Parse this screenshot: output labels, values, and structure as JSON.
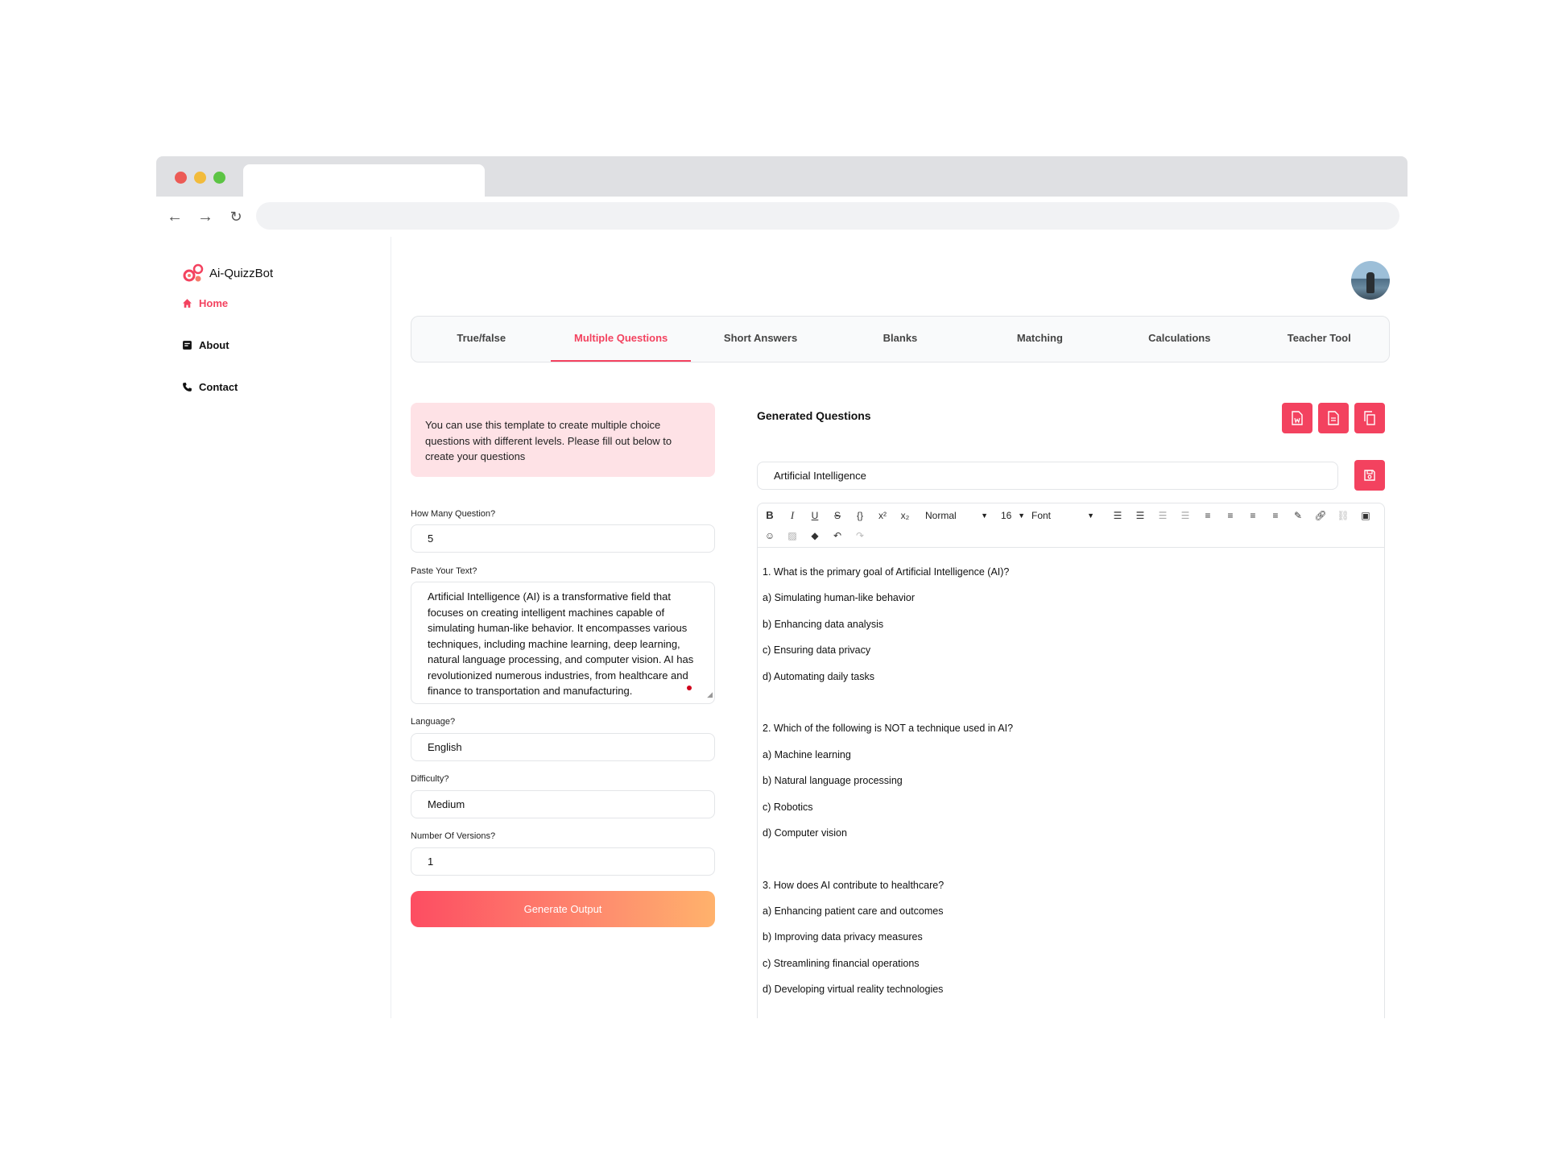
{
  "app": {
    "name": "Ai-QuizzBot"
  },
  "sidebar": {
    "items": [
      {
        "label": "Home",
        "icon": "home-icon",
        "active": true
      },
      {
        "label": "About",
        "icon": "document-icon",
        "active": false
      },
      {
        "label": "Contact",
        "icon": "phone-icon",
        "active": false
      }
    ]
  },
  "tabs": [
    "True/false",
    "Multiple Questions",
    "Short Answers",
    "Blanks",
    "Matching",
    "Calculations",
    "Teacher Tool"
  ],
  "active_tab": "Multiple Questions",
  "form": {
    "info": "You can use this template to create multiple choice questions with different levels. Please fill out below to create your questions",
    "count_label": "How Many Question?",
    "count_value": "5",
    "text_label": "Paste Your Text?",
    "text_value": "Artificial Intelligence (AI) is a transformative field that focuses on creating intelligent machines capable of simulating human-like behavior. It encompasses various techniques, including machine learning, deep learning, natural language processing, and computer vision. AI has revolutionized numerous industries, from healthcare and finance to transportation and manufacturing.",
    "language_label": "Language?",
    "language_value": "English",
    "difficulty_label": "Difficulty?",
    "difficulty_value": "Medium",
    "versions_label": "Number Of Versions?",
    "versions_value": "1",
    "generate_label": "Generate Output"
  },
  "output": {
    "title": "Generated Questions",
    "topic": "Artificial Intelligence",
    "toolbar": {
      "style_select": "Normal",
      "size_select": "16",
      "font_select": "Font"
    },
    "lines": [
      "1. What is the primary goal of Artificial Intelligence (AI)?",
      "a) Simulating human-like behavior",
      "b) Enhancing data analysis",
      "c) Ensuring data privacy",
      "d) Automating daily tasks",
      "",
      "2. Which of the following is NOT a technique used in AI?",
      "a) Machine learning",
      "b) Natural language processing",
      "c) Robotics",
      "d) Computer vision",
      "",
      "3. How does AI contribute to healthcare?",
      "a) Enhancing patient care and outcomes",
      "b) Improving data privacy measures",
      "c) Streamlining financial operations",
      "d) Developing virtual reality technologies"
    ]
  },
  "colors": {
    "accent": "#f3425f",
    "info_bg": "#fee2e6"
  }
}
